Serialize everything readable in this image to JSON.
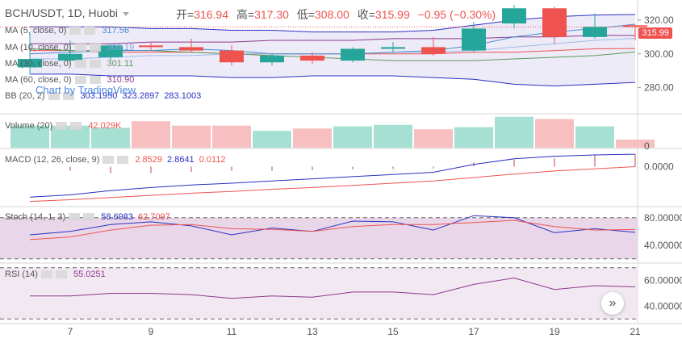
{
  "header": {
    "symbol": "BCH/USDT, 1D, Huobi",
    "open_label": "开=",
    "open": "316.94",
    "high_label": "高=",
    "high": "317.30",
    "low_label": "低=",
    "low": "308.00",
    "close_label": "收=",
    "close": "315.99",
    "change": "−0.95 (−0.30%)"
  },
  "watermark": "Chart by TradingView",
  "last_price_tag": "315.99",
  "indicators": {
    "ma5": {
      "label": "MA (5, close, 0)",
      "value": "317.56",
      "color": "#4a8cd4"
    },
    "ma10": {
      "label": "MA (10, close, 0)",
      "value": "309.19",
      "color": "#9bbbe6"
    },
    "ma30": {
      "label": "MA (30, close, 0)",
      "value": "301.11",
      "color": "#5a9a5a"
    },
    "ma60": {
      "label": "MA (60, close, 0)",
      "value": "310.90",
      "color": "#8a3a8a"
    },
    "bb": {
      "label": "BB (20, 2)",
      "basis": "303.1950",
      "upper": "323.2897",
      "lower": "283.1003",
      "color": "#2b2fc0"
    },
    "volume": {
      "label": "Volume (20)",
      "value": "42.029K"
    },
    "macd": {
      "label": "MACD (12, 26, close, 9)",
      "hist": "2.8529",
      "macd": "2.8641",
      "signal": "0.0112"
    },
    "stoch": {
      "label": "Stoch (14, 1, 3)",
      "k": "58.6983",
      "d": "62.7097"
    },
    "rsi": {
      "label": "RSI (14)",
      "value": "55.0251"
    }
  },
  "colors": {
    "up": "#26a69a",
    "down": "#ef5350",
    "up_vol": "#a6e0d3",
    "down_vol": "#f7bfbf",
    "band_fill": "#e8e6f6",
    "osc_fill": "#e2c9e2"
  },
  "chart_data": {
    "type": "candlestick",
    "x_ticks": [
      "7",
      "9",
      "11",
      "13",
      "15",
      "17",
      "19",
      "21"
    ],
    "candles": [
      {
        "day": 6,
        "o": 292,
        "h": 312,
        "l": 288,
        "c": 297
      },
      {
        "day": 7,
        "o": 296,
        "h": 308,
        "l": 294,
        "c": 300
      },
      {
        "day": 8,
        "o": 298,
        "h": 306,
        "l": 296,
        "c": 305
      },
      {
        "day": 9,
        "o": 305,
        "h": 307,
        "l": 302,
        "c": 304
      },
      {
        "day": 10,
        "o": 304,
        "h": 309,
        "l": 301,
        "c": 302
      },
      {
        "day": 11,
        "o": 302,
        "h": 305,
        "l": 293,
        "c": 295
      },
      {
        "day": 12,
        "o": 295,
        "h": 300,
        "l": 293,
        "c": 299
      },
      {
        "day": 13,
        "o": 299,
        "h": 301,
        "l": 294,
        "c": 296
      },
      {
        "day": 14,
        "o": 296,
        "h": 304,
        "l": 295,
        "c": 303
      },
      {
        "day": 15,
        "o": 303,
        "h": 307,
        "l": 301,
        "c": 304
      },
      {
        "day": 16,
        "o": 304,
        "h": 310,
        "l": 299,
        "c": 300
      },
      {
        "day": 17,
        "o": 302,
        "h": 319,
        "l": 301,
        "c": 315
      },
      {
        "day": 18,
        "o": 318,
        "h": 329,
        "l": 315,
        "c": 327
      },
      {
        "day": 19,
        "o": 327,
        "h": 328,
        "l": 306,
        "c": 310
      },
      {
        "day": 20,
        "o": 310,
        "h": 324,
        "l": 309,
        "c": 316
      },
      {
        "day": 21,
        "o": 316.94,
        "h": 317.3,
        "l": 308.0,
        "c": 315.99
      }
    ],
    "price_axis": {
      "ticks": [
        "280.00",
        "300.00",
        "320.00"
      ],
      "range": [
        265,
        330
      ]
    },
    "ma5": [
      300,
      301,
      302,
      302,
      303,
      302,
      300,
      300,
      300,
      301,
      302,
      305,
      310,
      313,
      315,
      317.56
    ],
    "ma10": [
      297,
      297,
      298,
      299,
      299,
      300,
      300,
      300,
      300,
      301,
      301,
      302,
      304,
      306,
      308,
      309.19
    ],
    "ma30": [
      303,
      302,
      302,
      302,
      301,
      300,
      299,
      298,
      297,
      296,
      296,
      296,
      297,
      298,
      299,
      301.11
    ],
    "ma60": [
      306,
      306,
      306,
      307,
      307,
      307,
      308,
      308,
      308,
      309,
      309,
      309,
      310,
      310,
      311,
      310.9
    ],
    "bb_upper": [
      316,
      316,
      316,
      315,
      315,
      314,
      314,
      313,
      313,
      313,
      314,
      317,
      320,
      322,
      323,
      323.29
    ],
    "bb_basis": [
      302,
      302,
      301,
      301,
      301,
      300,
      300,
      300,
      300,
      300,
      300,
      301,
      301,
      302,
      303,
      303.2
    ],
    "bb_lower": [
      288,
      288,
      287,
      287,
      287,
      286,
      286,
      287,
      287,
      287,
      286,
      285,
      282,
      281,
      282,
      283.1
    ],
    "volume": {
      "values": [
        30,
        30,
        27,
        36,
        30,
        30,
        23,
        26,
        29,
        31,
        25,
        28,
        42,
        39,
        29,
        11
      ],
      "tick": "0",
      "range": [
        0,
        45
      ]
    },
    "macd": {
      "hist": [
        0,
        -1,
        -1.5,
        -1.5,
        -1.2,
        -1.0,
        -1.0,
        -0.8,
        -0.6,
        -0.5,
        -0.4,
        1.0,
        1.6,
        1.9,
        2.6,
        2.85
      ],
      "macd": [
        -7,
        -6.5,
        -5.5,
        -4.8,
        -4.2,
        -3.8,
        -3.3,
        -2.8,
        -2.3,
        -1.8,
        -1.3,
        0.5,
        1.8,
        2.4,
        2.7,
        2.86
      ],
      "signal": [
        -8,
        -7.6,
        -7.1,
        -6.6,
        -6.1,
        -5.7,
        -5.2,
        -4.8,
        -4.3,
        -3.8,
        -3.3,
        -2.5,
        -1.7,
        -1.0,
        -0.5,
        0.01
      ],
      "tick": "0.0000",
      "range": [
        -9,
        4
      ]
    },
    "stoch": {
      "k": [
        55,
        60,
        70,
        74,
        68,
        55,
        65,
        60,
        75,
        74,
        62,
        83,
        80,
        58,
        64,
        58.7
      ],
      "d": [
        48,
        52,
        62,
        69,
        70,
        64,
        63,
        60,
        67,
        70,
        70,
        73,
        76,
        67,
        62,
        62.71
      ],
      "ticks": [
        "40.00000",
        "80.00000"
      ],
      "range": [
        15,
        95
      ],
      "bands": [
        80,
        20
      ]
    },
    "rsi": {
      "values": [
        48,
        48,
        50,
        50,
        49,
        46,
        48,
        47,
        51,
        51,
        49,
        57,
        62,
        53,
        56,
        55.03
      ],
      "ticks": [
        "40.00000",
        "60.00000"
      ],
      "range": [
        27,
        73
      ],
      "bands": [
        70,
        30
      ]
    }
  }
}
